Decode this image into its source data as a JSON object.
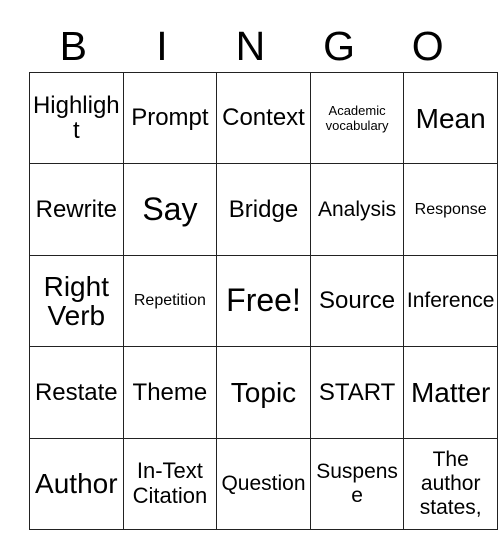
{
  "card": {
    "header_letters": [
      "B",
      "I",
      "N",
      "G",
      "O"
    ],
    "rows": [
      [
        {
          "text": "Highlight",
          "size": "s-xl"
        },
        {
          "text": "Prompt",
          "size": "s-xl"
        },
        {
          "text": "Context",
          "size": "s-xl"
        },
        {
          "text": "Academic vocabulary",
          "size": "s-xs"
        },
        {
          "text": "Mean",
          "size": "s-2xl"
        }
      ],
      [
        {
          "text": "Rewrite",
          "size": "s-xl"
        },
        {
          "text": "Say",
          "size": "s-3xl"
        },
        {
          "text": "Bridge",
          "size": "s-xl"
        },
        {
          "text": "Analysis",
          "size": "s-md"
        },
        {
          "text": "Response",
          "size": "s-sm"
        }
      ],
      [
        {
          "text": "Right Verb",
          "size": "s-2xl"
        },
        {
          "text": "Repetition",
          "size": "s-sm"
        },
        {
          "text": "Free!",
          "size": "s-3xl"
        },
        {
          "text": "Source",
          "size": "s-xl"
        },
        {
          "text": "Inference",
          "size": "s-md"
        }
      ],
      [
        {
          "text": "Restate",
          "size": "s-xl"
        },
        {
          "text": "Theme",
          "size": "s-xl"
        },
        {
          "text": "Topic",
          "size": "s-2xl"
        },
        {
          "text": "START",
          "size": "s-xl"
        },
        {
          "text": "Matter",
          "size": "s-2xl"
        }
      ],
      [
        {
          "text": "Author",
          "size": "s-2xl"
        },
        {
          "text": "In-Text Citation",
          "size": "s-lg"
        },
        {
          "text": "Question",
          "size": "s-md"
        },
        {
          "text": "Suspense",
          "size": "s-md"
        },
        {
          "text": "The author states,",
          "size": "s-md"
        }
      ]
    ]
  },
  "colors": {
    "background": "#ffffff",
    "text": "#000000",
    "border": "#222222"
  }
}
